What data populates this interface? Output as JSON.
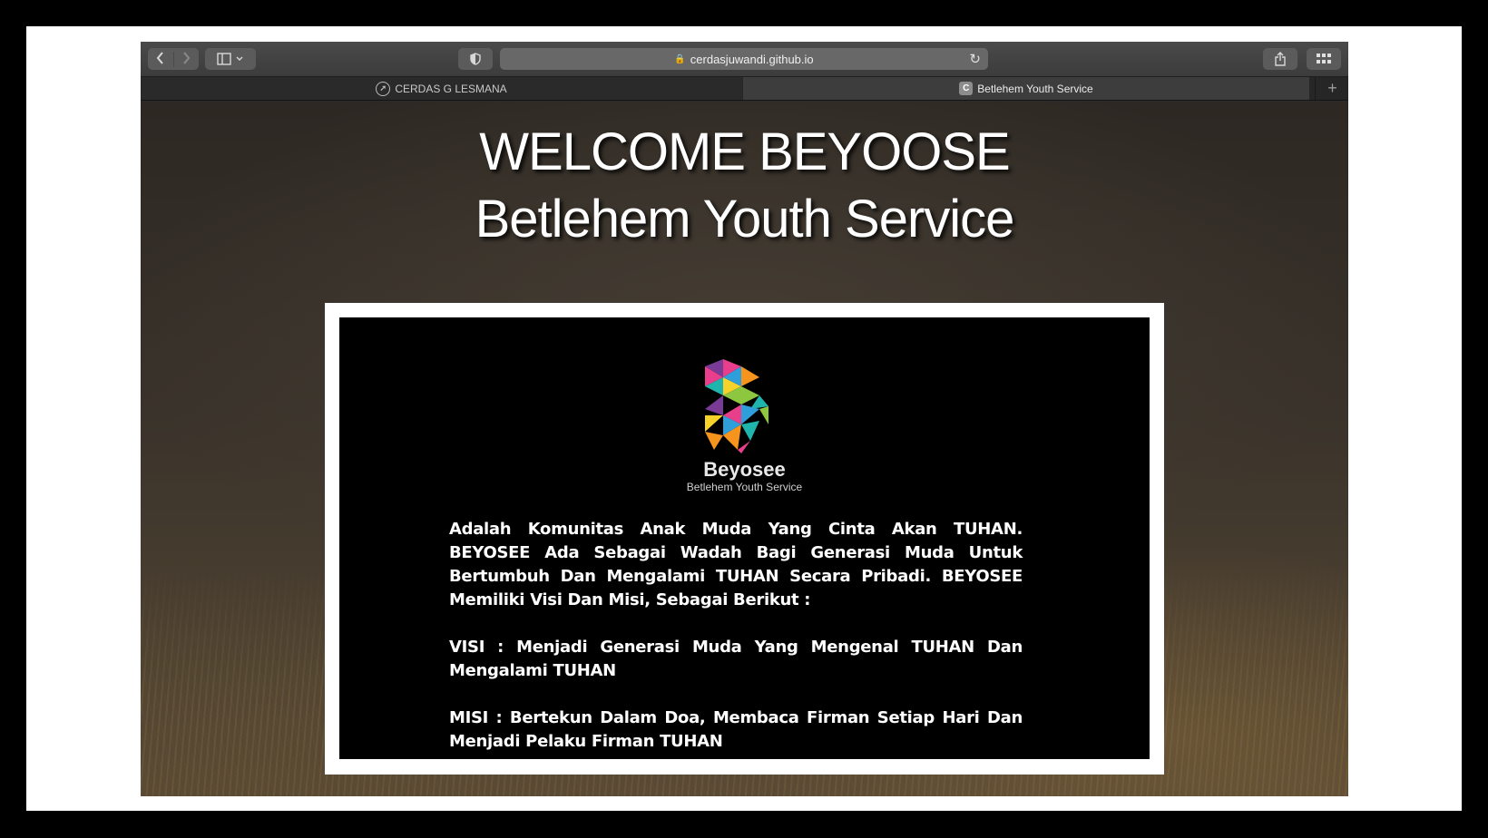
{
  "browser": {
    "address": "cerdasjuwandi.github.io",
    "tabs": [
      {
        "label": "CERDAS G LESMANA",
        "active": false
      },
      {
        "label": "Betlehem Youth Service",
        "active": true,
        "favicon": "C"
      }
    ],
    "new_tab_label": "+"
  },
  "page": {
    "heading_line1": "WELCOME BEYOOSE",
    "heading_line2": "Betlehem Youth Service",
    "brand_name": "Beyosee",
    "brand_tagline": "Betlehem Youth Service",
    "intro": "Adalah Komunitas Anak Muda Yang Cinta Akan TUHAN. BEYOSEE Ada Sebagai Wadah Bagi Generasi Muda Untuk Bertumbuh Dan Mengalami TUHAN Secara Pribadi. BEYOSEE Memiliki Visi Dan Misi, Sebagai Berikut :",
    "visi": "VISI : Menjadi Generasi Muda Yang Mengenal TUHAN Dan Mengalami TUHAN",
    "misi": "MISI : Bertekun Dalam Doa, Membaca Firman Setiap Hari Dan Menjadi Pelaku Firman TUHAN"
  },
  "colors": {
    "logo_pink": "#e83e8c",
    "logo_orange": "#f7941d",
    "logo_yellow": "#f6d22b",
    "logo_green": "#8dc63f",
    "logo_teal": "#1fb5ad",
    "logo_blue": "#2e9fdb",
    "logo_purple": "#7a3b96"
  },
  "icons": {
    "back": "chevron-left-icon",
    "forward": "chevron-right-icon",
    "sidebar": "sidebar-icon",
    "shield": "shield-icon",
    "lock": "lock-icon",
    "reload": "reload-icon",
    "share": "share-icon",
    "grid": "grid-icon"
  }
}
